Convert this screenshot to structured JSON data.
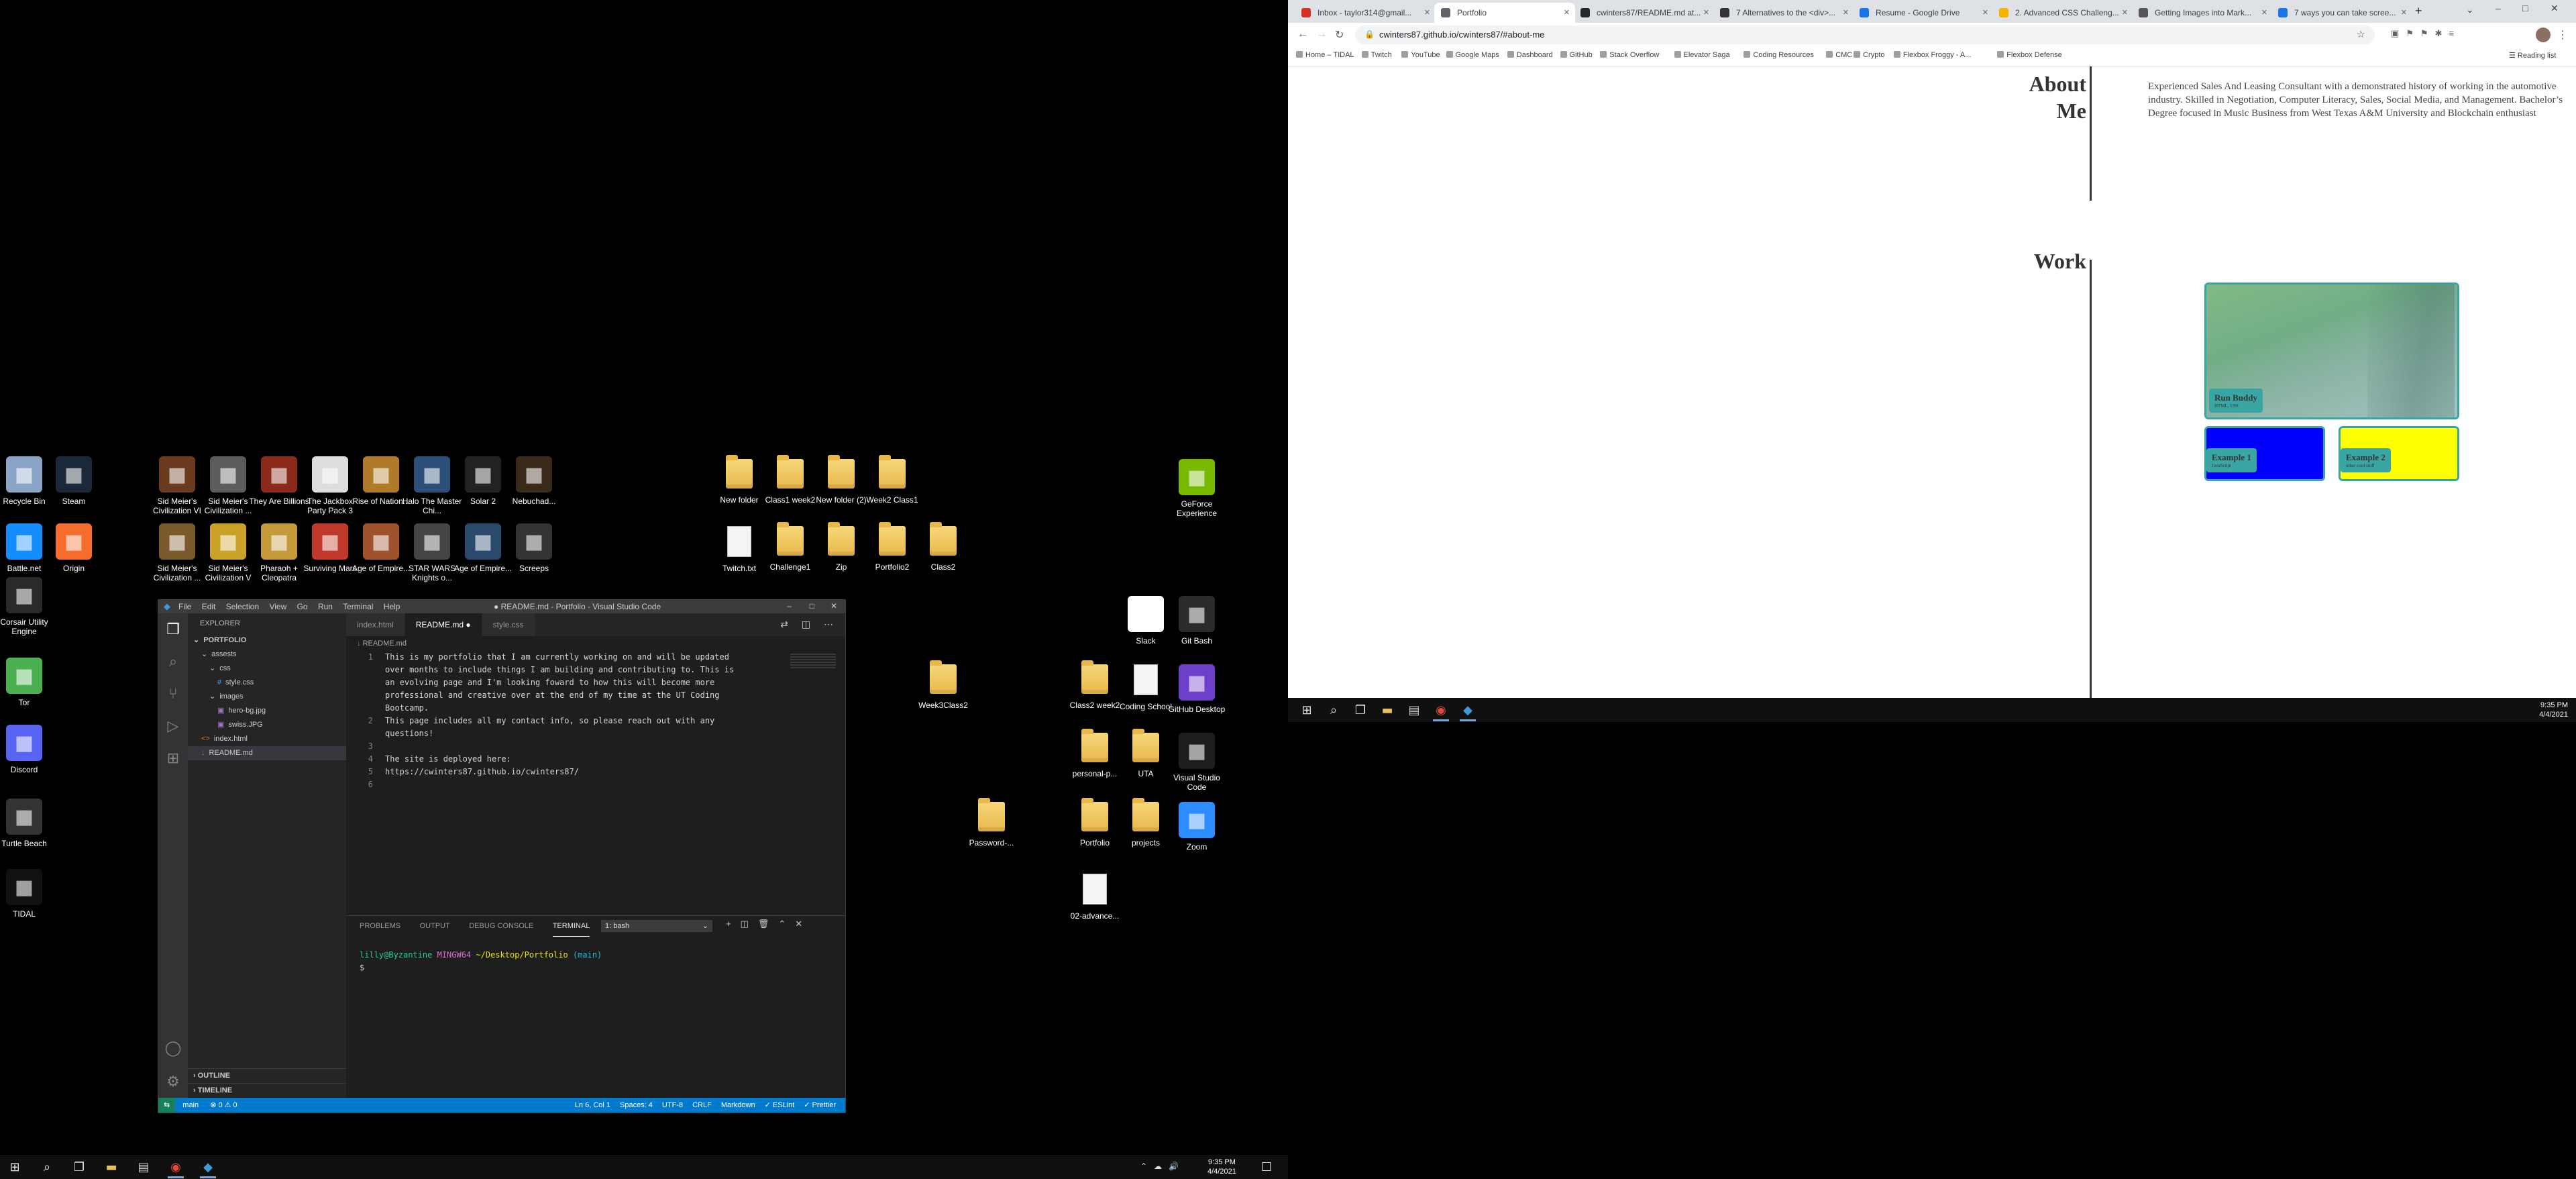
{
  "desktop": {
    "left_icons": [
      {
        "label": "Recycle Bin",
        "icon": "recycle-bin-icon",
        "color": "#8aa4c8"
      },
      {
        "label": "Steam",
        "icon": "steam-icon",
        "color": "#1b2838"
      },
      {
        "label": "Battle.net",
        "icon": "battlenet-icon",
        "color": "#148eff"
      },
      {
        "label": "Origin",
        "icon": "origin-icon",
        "color": "#f56c2d"
      },
      {
        "label": "Corsair Utility Engine",
        "icon": "corsair-icon",
        "color": "#2a2a2a"
      },
      {
        "label": "Tor",
        "icon": "tor-icon",
        "color": "#4caf50"
      },
      {
        "label": "Discord",
        "icon": "discord-icon",
        "color": "#5865f2"
      },
      {
        "label": "Turtle Beach",
        "icon": "turtle-beach-icon",
        "color": "#333333"
      },
      {
        "label": "TIDAL",
        "icon": "tidal-icon",
        "color": "#111111"
      }
    ],
    "game_icons": [
      {
        "label": "Sid Meier's Civilization VI",
        "icon": "civ6-icon",
        "color": "#6b3a1e"
      },
      {
        "label": "Sid Meier's Civilization ...",
        "icon": "civ-beyond-icon",
        "color": "#5c5c5c"
      },
      {
        "label": "They Are Billions",
        "icon": "they-are-billions-icon",
        "color": "#8b2a1a"
      },
      {
        "label": "The Jackbox Party Pack 3",
        "icon": "jackbox-icon",
        "color": "#dddddd"
      },
      {
        "label": "Rise of Nation...",
        "icon": "rise-of-nations-icon",
        "color": "#b07a2a"
      },
      {
        "label": "Halo The Master Chi...",
        "icon": "halo-icon",
        "color": "#2c4f7a"
      },
      {
        "label": "Solar 2",
        "icon": "solar2-icon",
        "color": "#222222"
      },
      {
        "label": "Nebuchad...",
        "icon": "nebuchadnezzar-icon",
        "color": "#3a2a1a"
      },
      {
        "label": "Sid Meier's Civilization ...",
        "icon": "civ4-icon",
        "color": "#7a5a2a"
      },
      {
        "label": "Sid Meier's Civilization V",
        "icon": "civ5-icon",
        "color": "#c9a227"
      },
      {
        "label": "Pharaoh + Cleopatra",
        "icon": "pharaoh-icon",
        "color": "#c49a3a"
      },
      {
        "label": "Surviving Mars",
        "icon": "surviving-mars-icon",
        "color": "#c0392b"
      },
      {
        "label": "Age of Empire...",
        "icon": "aoe-icon",
        "color": "#a0522d"
      },
      {
        "label": "STAR WARS Knights o...",
        "icon": "kotor-icon",
        "color": "#444444"
      },
      {
        "label": "Age of Empire...",
        "icon": "aoe-de-icon",
        "color": "#2b4a6b"
      },
      {
        "label": "Screeps",
        "icon": "screeps-icon",
        "color": "#333333"
      }
    ],
    "folder_icons": [
      {
        "label": "New folder",
        "type": "folder"
      },
      {
        "label": "Class1 week2",
        "type": "folder"
      },
      {
        "label": "New folder (2)",
        "type": "folder"
      },
      {
        "label": "Week2 Class1",
        "type": "folder"
      },
      {
        "label": "Twitch.txt",
        "type": "doc"
      },
      {
        "label": "Challenge1",
        "type": "folder"
      },
      {
        "label": "Zip",
        "type": "folder"
      },
      {
        "label": "Portfolio2",
        "type": "folder"
      },
      {
        "label": "Class2",
        "type": "folder"
      }
    ],
    "right_icons": [
      {
        "label": "GeForce Experience",
        "icon": "geforce-icon",
        "color": "#76b900",
        "type": "app"
      },
      {
        "label": "Slack",
        "icon": "slack-icon",
        "color": "#ffffff",
        "type": "app"
      },
      {
        "label": "Git Bash",
        "icon": "git-bash-icon",
        "color": "#2b2b2b",
        "type": "app"
      },
      {
        "label": "Week3Class2",
        "icon": "folder-icon",
        "type": "folder"
      },
      {
        "label": "Class2 week2",
        "icon": "folder-icon",
        "type": "folder"
      },
      {
        "label": "Coding School",
        "icon": "folder-icon",
        "type": "doc"
      },
      {
        "label": "GitHub Desktop",
        "icon": "github-desktop-icon",
        "color": "#6e40c9",
        "type": "app"
      },
      {
        "label": "personal-p...",
        "icon": "folder-icon",
        "type": "folder"
      },
      {
        "label": "UTA",
        "icon": "folder-icon",
        "type": "folder"
      },
      {
        "label": "Visual Studio Code",
        "icon": "vscode-icon",
        "color": "#1e1e1e",
        "type": "app"
      },
      {
        "label": "Password-...",
        "icon": "folder-icon",
        "type": "folder"
      },
      {
        "label": "Portfolio",
        "icon": "folder-icon",
        "type": "folder"
      },
      {
        "label": "projects",
        "icon": "folder-icon",
        "type": "folder"
      },
      {
        "label": "Zoom",
        "icon": "zoom-icon",
        "color": "#2d8cff",
        "type": "app"
      },
      {
        "label": "02-advance...",
        "icon": "image-file-icon",
        "type": "doc"
      }
    ]
  },
  "vscode": {
    "menu": [
      "File",
      "Edit",
      "Selection",
      "View",
      "Go",
      "Run",
      "Terminal",
      "Help"
    ],
    "window_title": "● README.md - Portfolio - Visual Studio Code",
    "explorer_title": "EXPLORER",
    "tree": [
      {
        "label": "PORTFOLIO",
        "indent": 0,
        "kind": "root"
      },
      {
        "label": "assests",
        "indent": 1,
        "kind": "folder"
      },
      {
        "label": "css",
        "indent": 2,
        "kind": "folder"
      },
      {
        "label": "style.css",
        "indent": 3,
        "kind": "css"
      },
      {
        "label": "images",
        "indent": 2,
        "kind": "folder"
      },
      {
        "label": "hero-bg.jpg",
        "indent": 3,
        "kind": "img"
      },
      {
        "label": "swiss.JPG",
        "indent": 3,
        "kind": "img"
      },
      {
        "label": "index.html",
        "indent": 1,
        "kind": "html"
      },
      {
        "label": "README.md",
        "indent": 1,
        "kind": "md"
      }
    ],
    "outline_label": "OUTLINE",
    "timeline_label": "TIMELINE",
    "tabs": [
      {
        "label": "index.html",
        "active": false
      },
      {
        "label": "README.md ●",
        "active": true
      },
      {
        "label": "style.css",
        "active": false
      }
    ],
    "breadcrumb": "README.md",
    "code_lines": [
      {
        "n": "1",
        "text": "This is my portfolio that I am currently working on and will be updated"
      },
      {
        "n": "",
        "text": "over months to include things I am building and contributing to. This is"
      },
      {
        "n": "",
        "text": "an evolving page and I'm looking foward to how this will become more"
      },
      {
        "n": "",
        "text": "professional and creative over at the end of my time at the UT Coding"
      },
      {
        "n": "",
        "text": "Bootcamp."
      },
      {
        "n": "2",
        "text": "This page includes all my contact info, so please reach out with any"
      },
      {
        "n": "",
        "text": "questions!"
      },
      {
        "n": "3",
        "text": ""
      },
      {
        "n": "4",
        "text": "The site is deployed here:"
      },
      {
        "n": "5",
        "text": "https://cwinters87.github.io/cwinters87/"
      },
      {
        "n": "6",
        "text": ""
      }
    ],
    "panel_tabs": [
      "PROBLEMS",
      "OUTPUT",
      "DEBUG CONSOLE",
      "TERMINAL"
    ],
    "terminal_select": "1: bash",
    "prompt_user": "lilly@Byzantine",
    "prompt_env": "MINGW64",
    "prompt_path": "~/Desktop/Portfolio",
    "prompt_branch": "(main)",
    "prompt_symbol": "$",
    "status_left": [
      "main",
      "⊗ 0 ⚠ 0"
    ],
    "status_right": [
      "Ln 6, Col 1",
      "Spaces: 4",
      "UTF-8",
      "CRLF",
      "Markdown",
      "✓ ESLint",
      "✓ Prettier"
    ]
  },
  "chrome": {
    "tabs": [
      {
        "label": "Inbox - taylor314@gmail...",
        "color": "#d93025",
        "active": false
      },
      {
        "label": "Portfolio",
        "color": "#5f6368",
        "active": true
      },
      {
        "label": "cwinters87/README.md at...",
        "color": "#24292e",
        "active": false
      },
      {
        "label": "7 Alternatives to the <div>...",
        "color": "#333333",
        "active": false
      },
      {
        "label": "Resume - Google Drive",
        "color": "#1a73e8",
        "active": false
      },
      {
        "label": "2. Advanced CSS Challeng...",
        "color": "#f4b400",
        "active": false
      },
      {
        "label": "Getting Images into Mark...",
        "color": "#555555",
        "active": false
      },
      {
        "label": "7 ways you can take scree...",
        "color": "#1a73e8",
        "active": false
      }
    ],
    "url": "cwinters87.github.io/cwinters87/#about-me",
    "bookmarks": [
      "Home – TIDAL",
      "Twitch",
      "YouTube",
      "Google Maps",
      "Dashboard",
      "GitHub",
      "Stack Overflow",
      "Elevator Saga",
      "Coding Resources",
      "CMC",
      "Crypto",
      "Flexbox Froggy - A...",
      "Flexbox Defense"
    ],
    "reading_list": "Reading list"
  },
  "portfolio": {
    "about_heading_1": "About",
    "about_heading_2": "Me",
    "about_text": "Experienced Sales And Leasing Consultant with a demonstrated history of working in the automotive industry. Skilled in Negotiation, Computer Literacy, Sales, Social Media, and Management. Bachelor’s Degree focused in Music Business from West Texas A&M University and Blockchain enthusiast",
    "work_heading": "Work",
    "cards": [
      {
        "title": "Run Buddy",
        "subtitle": "HTML, CSS",
        "color": "#7fb59a"
      },
      {
        "title": "Example 1",
        "subtitle": "JavaScript",
        "color": "#0000ff"
      },
      {
        "title": "Example 2",
        "subtitle": "other cool stuff",
        "color": "#ffff00"
      }
    ],
    "accent": "#39a6a3"
  },
  "taskbar": {
    "time_bottom": "9:35 PM",
    "date_bottom": "4/4/2021",
    "time_right": "9:35 PM",
    "date_right": "4/4/2021"
  }
}
